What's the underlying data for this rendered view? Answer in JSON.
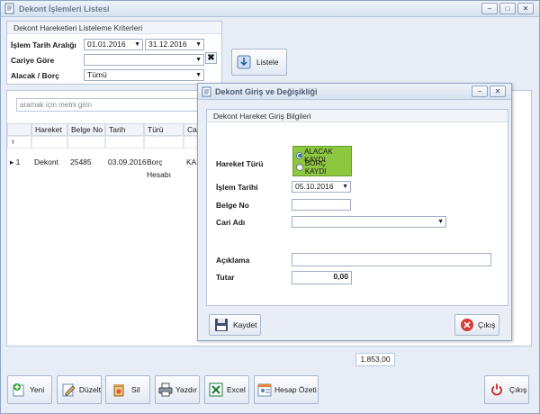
{
  "window": {
    "title": "Dekont İşlemleri Listesi",
    "min": "‒",
    "max": "□",
    "close": "✕"
  },
  "criteria": {
    "header": "Dekont Hareketleri Listeleme Kriterleri",
    "date_label": "İşlem Tarih Aralığı",
    "date_from": "01.01.2016",
    "date_to": "31.12.2016",
    "cari_label": "Cariye Göre",
    "cari_value": "",
    "ab_label": "Alacak / Borç",
    "ab_value": "Tümü",
    "clear_symbol": "✖",
    "list_button": "Listele"
  },
  "grid": {
    "search_placeholder": "aramak için metni girin",
    "columns": [
      "Hareket",
      "Belge No",
      "Tarih",
      "Türü",
      "Cari A"
    ],
    "filter_symbol": "ᵞ",
    "rows": [
      {
        "indicator": "▸ 1",
        "hareket": "Dekont",
        "belge_no": "25485",
        "tarih": "03.09.2016",
        "turu": "Borç Hesabı",
        "cari": "KARA"
      }
    ],
    "total": "1.853,00"
  },
  "toolbar": {
    "new": "Yeni",
    "edit": "Düzelt",
    "delete": "Sil",
    "print": "Yazdır",
    "excel": "Excel",
    "summary": "Hesap Özeti",
    "exit": "Çıkış"
  },
  "dialog": {
    "title": "Dekont Giriş ve Değişikliği",
    "min": "‒",
    "close": "✕",
    "panel_header": "Dekont Hareket Giriş Bilgileri",
    "type_label": "Hareket Türü",
    "options": [
      "ALACAK KAYDI",
      "BORÇ KAYDI"
    ],
    "selected_option": "ALACAK KAYDI",
    "date_label": "İşlem Tarihi",
    "date_value": "05.10.2016",
    "doc_label": "Belge No",
    "doc_value": "",
    "cari_label": "Cari Adı",
    "cari_value": "",
    "desc_label": "Açıklama",
    "desc_value": "",
    "amount_label": "Tutar",
    "amount_value": "0,00",
    "save": "Kaydet",
    "exit": "Çıkış"
  },
  "colors": {
    "accent": "#8dc63f",
    "window_bg": "#e7edf6",
    "title": "#707d8f"
  },
  "icons": [
    "app-icon",
    "list-icon",
    "add-icon",
    "edit-icon",
    "delete-icon",
    "print-icon",
    "excel-icon",
    "report-icon",
    "power-icon",
    "save-icon",
    "exit-icon"
  ]
}
